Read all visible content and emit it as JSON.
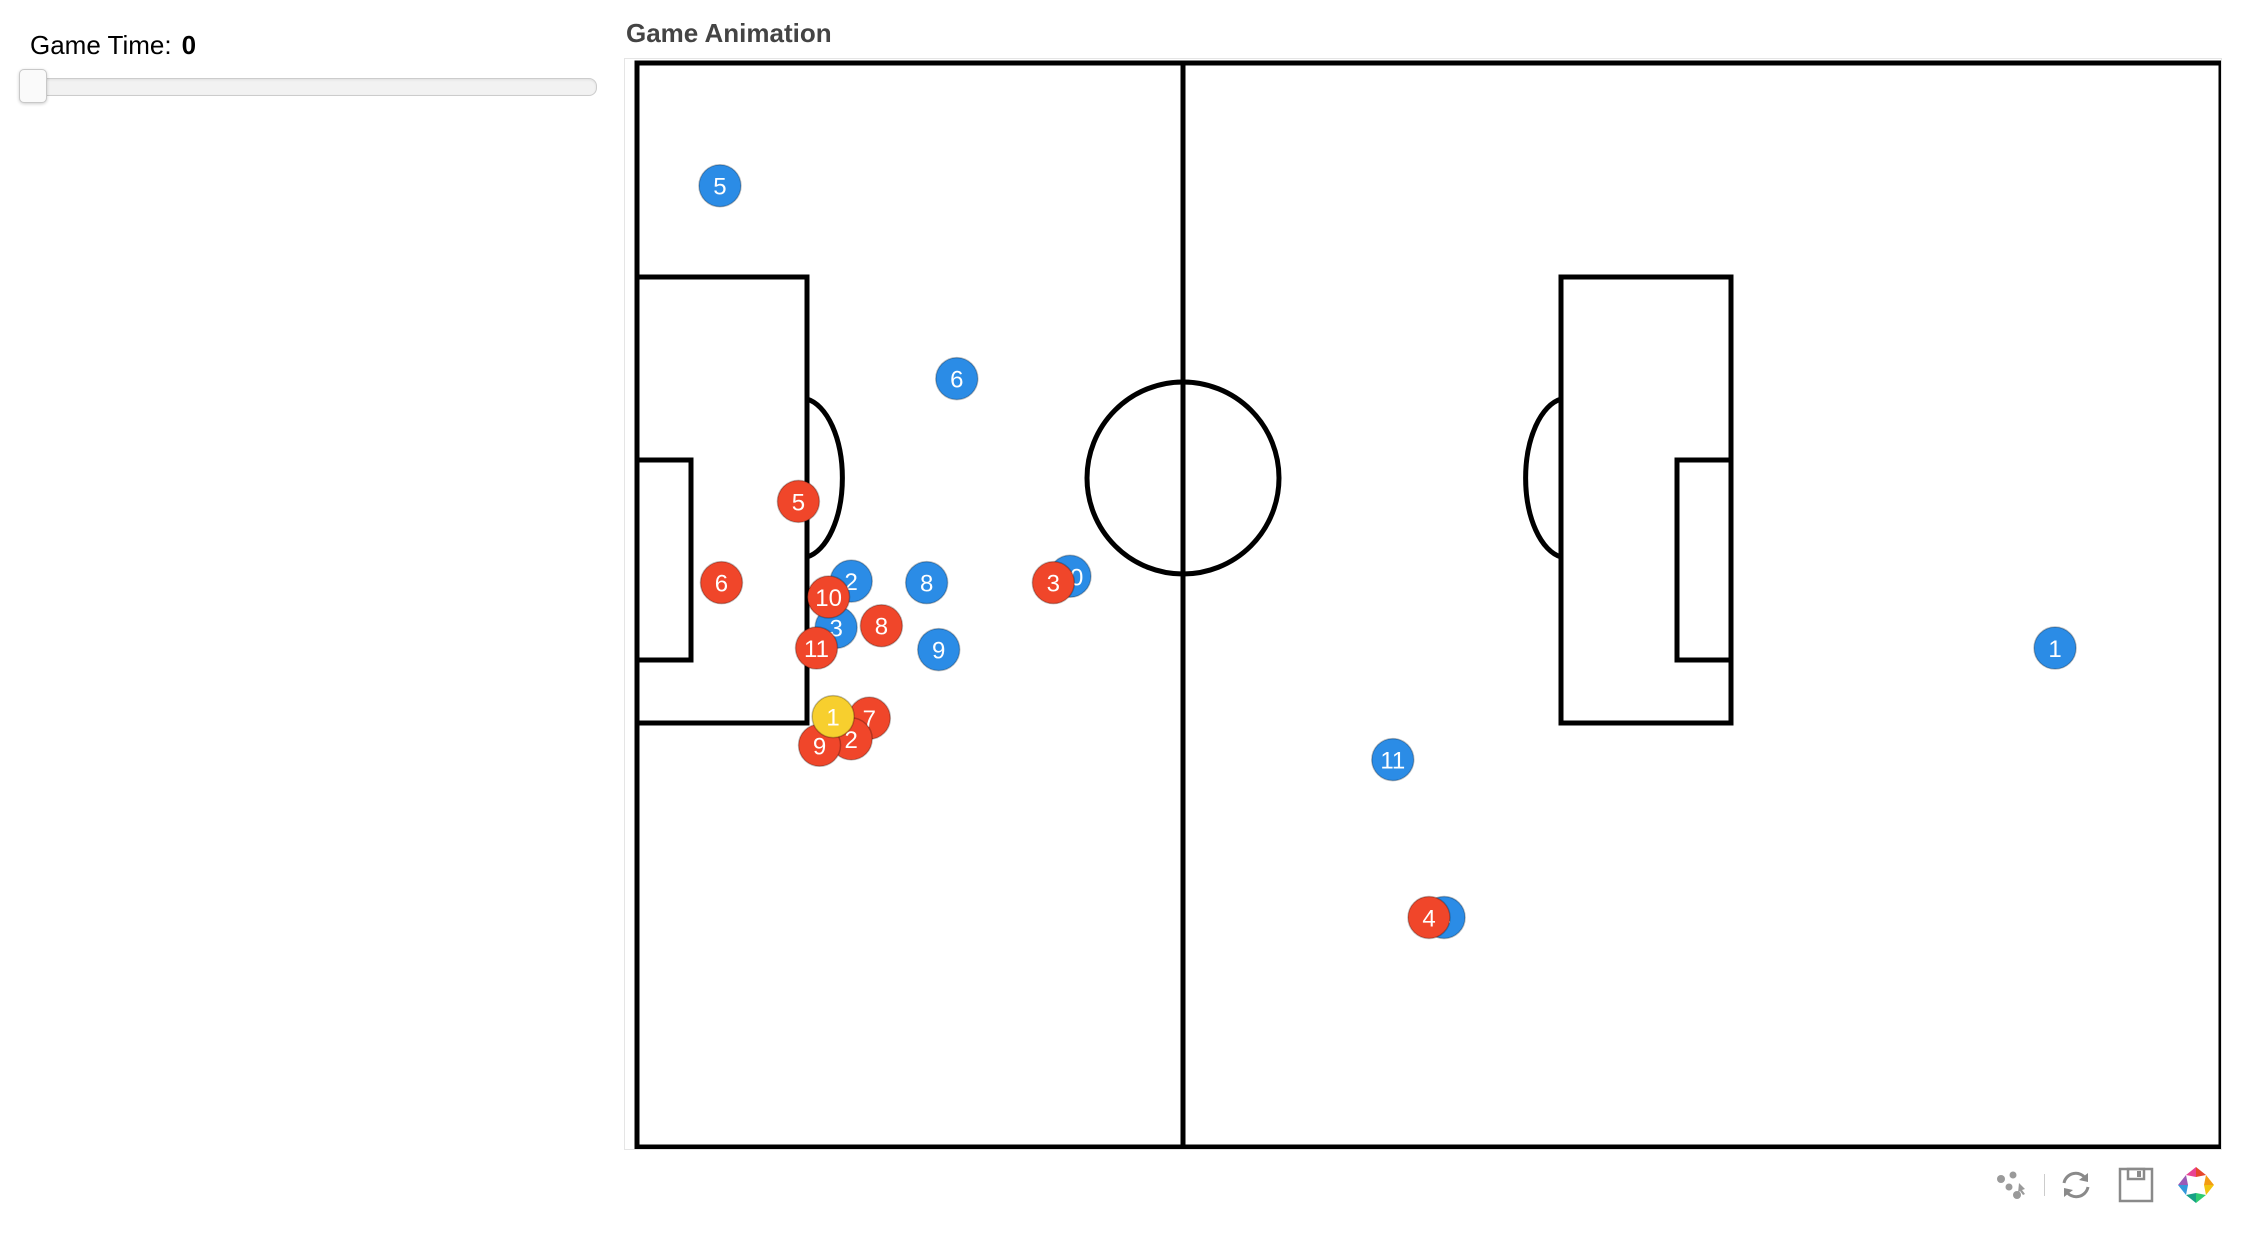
{
  "controls": {
    "slider_title": "Game Time:",
    "slider_value": "0",
    "slider_fraction": 0
  },
  "plot": {
    "title": "Game Animation"
  },
  "colors": {
    "team_blue": "#2b8ce6",
    "team_red": "#f0462a",
    "ball": "#f7cf2e",
    "pitch_lines": "#000000",
    "background": "#ffffff"
  },
  "players": [
    {
      "team": "blue",
      "number": "5",
      "x": 5.5,
      "y": 60.3
    },
    {
      "team": "blue",
      "number": "6",
      "x": 21.2,
      "y": 48.2
    },
    {
      "team": "blue",
      "number": "2",
      "x": 14.2,
      "y": 35.5
    },
    {
      "team": "blue",
      "number": "8",
      "x": 19.2,
      "y": 35.4
    },
    {
      "team": "blue",
      "number": "3",
      "x": 13.2,
      "y": 32.6
    },
    {
      "team": "blue",
      "number": "9",
      "x": 20.0,
      "y": 31.2
    },
    {
      "team": "blue",
      "number": "10",
      "x": 28.7,
      "y": 35.8
    },
    {
      "team": "blue",
      "number": "11",
      "x": 50.1,
      "y": 24.3
    },
    {
      "team": "blue",
      "number": "4",
      "x": 53.5,
      "y": 14.4
    },
    {
      "team": "blue",
      "number": "1",
      "x": 94.0,
      "y": 31.3
    },
    {
      "team": "red",
      "number": "5",
      "x": 10.7,
      "y": 40.5
    },
    {
      "team": "red",
      "number": "6",
      "x": 5.6,
      "y": 35.4
    },
    {
      "team": "red",
      "number": "10",
      "x": 12.7,
      "y": 34.5
    },
    {
      "team": "red",
      "number": "8",
      "x": 16.2,
      "y": 32.7
    },
    {
      "team": "red",
      "number": "11",
      "x": 11.9,
      "y": 31.3
    },
    {
      "team": "red",
      "number": "3",
      "x": 27.6,
      "y": 35.4
    },
    {
      "team": "red",
      "number": "7",
      "x": 15.4,
      "y": 26.9
    },
    {
      "team": "red",
      "number": "2",
      "x": 14.2,
      "y": 25.6
    },
    {
      "team": "red",
      "number": "9",
      "x": 12.1,
      "y": 25.2
    },
    {
      "team": "red",
      "number": "4",
      "x": 52.5,
      "y": 14.4
    }
  ],
  "ball": {
    "label": "1",
    "x": 13.0,
    "y": 27.0
  },
  "toolbar": {
    "tools": [
      "pan-icon",
      "reset-icon",
      "save-icon",
      "bokeh-logo-icon"
    ]
  }
}
